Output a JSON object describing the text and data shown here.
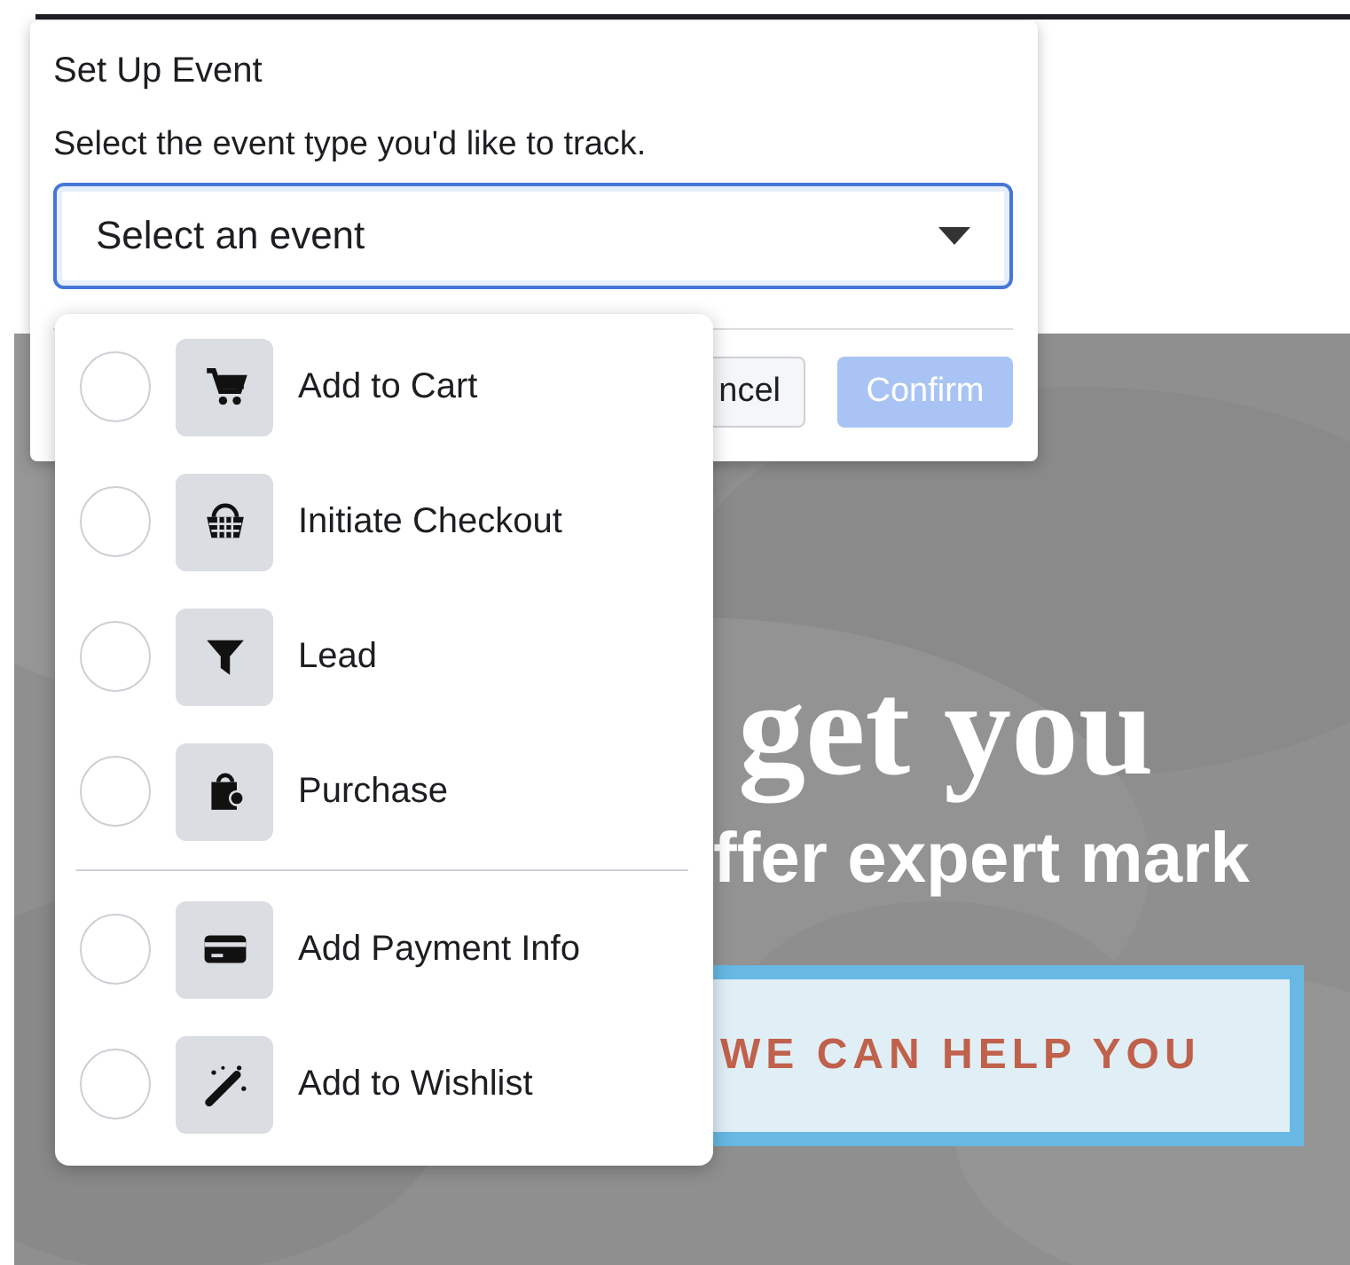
{
  "hero": {
    "heading": "get you",
    "subheading": "ffer expert mark",
    "button": "WE CAN HELP YOU"
  },
  "dialog": {
    "title": "Set Up Event",
    "prompt": "Select the event type you'd like to track.",
    "select": {
      "placeholder": "Select an event",
      "expanded": true
    },
    "buttons": [
      {
        "label": "ncel",
        "kind": "secondary",
        "disabled": false
      },
      {
        "label": "Confirm",
        "kind": "primary",
        "disabled": true
      }
    ]
  },
  "event_menu": {
    "groups": [
      [
        {
          "label": "Add to Cart",
          "selected": false
        },
        {
          "label": "Initiate Checkout",
          "selected": false
        },
        {
          "label": "Lead",
          "selected": false
        },
        {
          "label": "Purchase",
          "selected": false
        }
      ],
      [
        {
          "label": "Add Payment Info",
          "selected": false
        },
        {
          "label": "Add to Wishlist",
          "selected": false
        }
      ]
    ]
  }
}
